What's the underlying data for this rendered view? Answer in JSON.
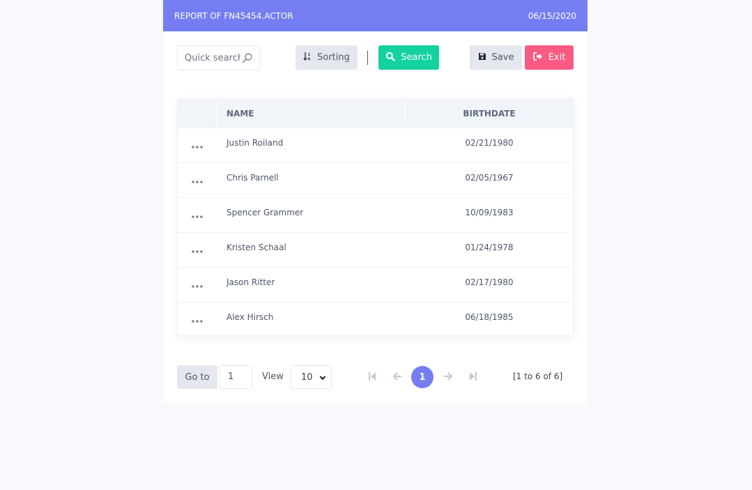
{
  "header": {
    "title": "REPORT OF FN45454.ACTOR",
    "date": "06/15/2020"
  },
  "toolbar": {
    "quick_search_placeholder": "Quick search",
    "sorting_label": "Sorting",
    "search_label": "Search",
    "save_label": "Save",
    "exit_label": "Exit"
  },
  "table": {
    "columns": [
      "NAME",
      "BIRTHDATE"
    ],
    "rows": [
      {
        "name": "Justin Roiland",
        "birthdate": "02/21/1980"
      },
      {
        "name": "Chris Parnell",
        "birthdate": "02/05/1967"
      },
      {
        "name": "Spencer Grammer",
        "birthdate": "10/09/1983"
      },
      {
        "name": "Kristen Schaal",
        "birthdate": "01/24/1978"
      },
      {
        "name": "Jason Ritter",
        "birthdate": "02/17/1980"
      },
      {
        "name": "Alex Hirsch",
        "birthdate": "06/18/1985"
      }
    ]
  },
  "pagination": {
    "goto_label": "Go to",
    "goto_value": "1",
    "view_label": "View",
    "view_value": "10",
    "current_page": "1",
    "range_text": "[1 to 6 of 6]"
  },
  "colors": {
    "header_bg": "#747ef2",
    "search_button": "#14d2a0",
    "exit_button": "#fb5a82",
    "neutral_button": "#e4e8ee"
  }
}
